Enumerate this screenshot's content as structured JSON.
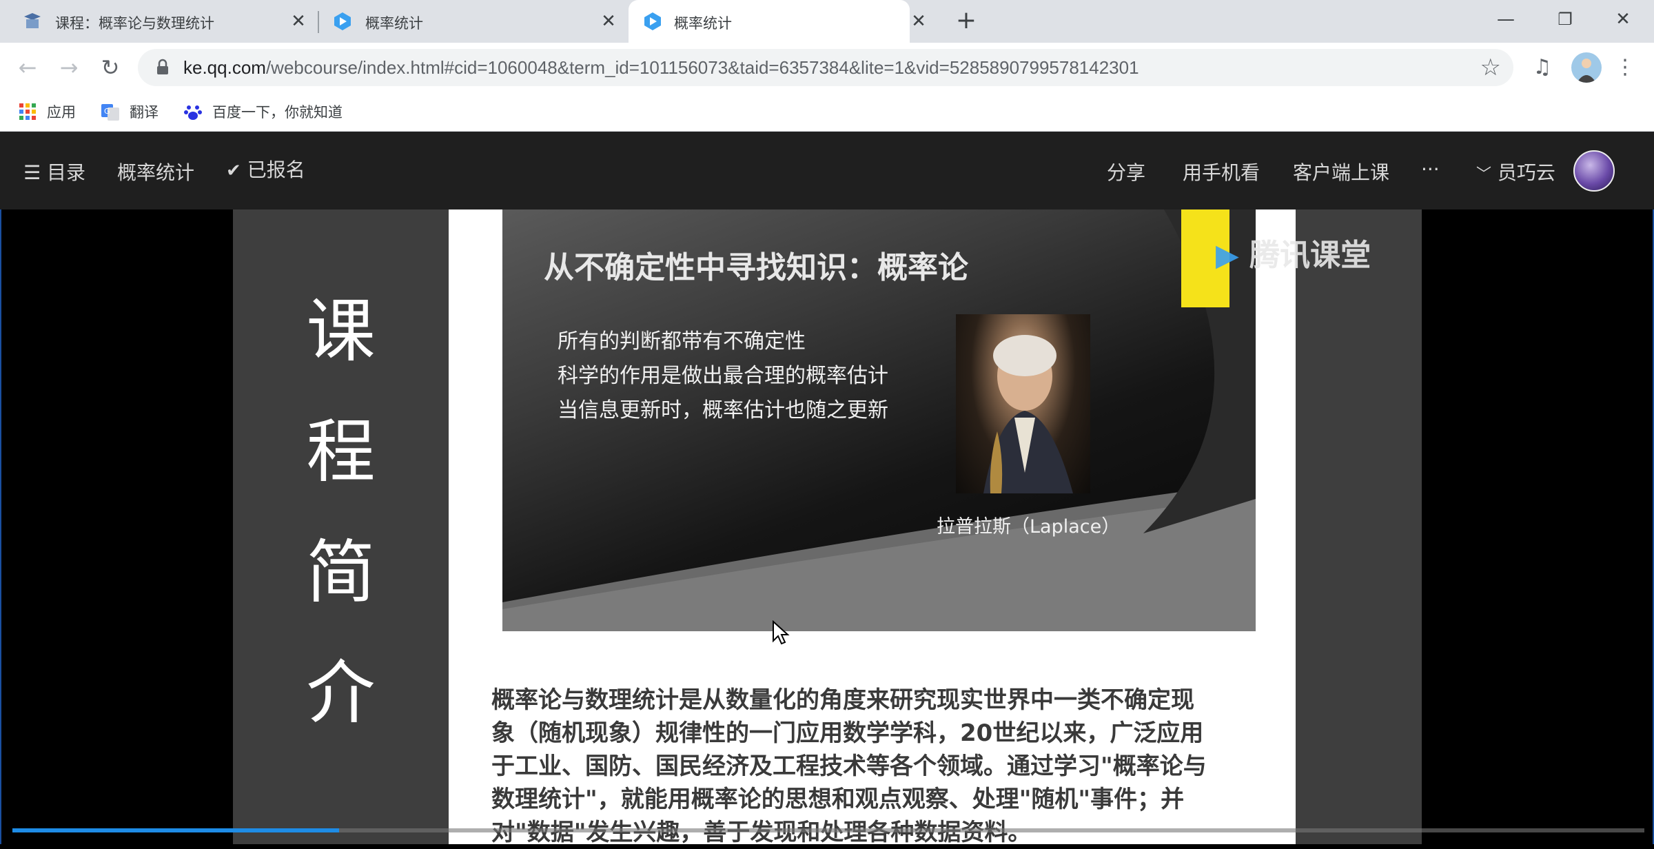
{
  "tabs": [
    {
      "title": "课程：概率论与数理统计",
      "active": false
    },
    {
      "title": "概率统计",
      "active": false
    },
    {
      "title": "概率统计",
      "active": true
    }
  ],
  "toolbar": {
    "url_host": "ke.qq.com",
    "url_path": "/webcourse/index.html#cid=1060048&term_id=101156073&taid=6357384&lite=1&vid=5285890799578142301"
  },
  "bookmarks": [
    {
      "label": "应用",
      "icon": "apps-grid-icon"
    },
    {
      "label": "翻译",
      "icon": "translate-icon"
    },
    {
      "label": "百度一下，你就知道",
      "icon": "baidu-paw-icon"
    }
  ],
  "header": {
    "menu_label": "☰ 目录",
    "course_label": "概率统计",
    "enrolled_label": "已报名",
    "share_label": "分享",
    "mobile_label": "用手机看",
    "client_label": "客户端上课",
    "more_label": "···",
    "user_name": "员巧云"
  },
  "video": {
    "side_title_chars": [
      "课",
      "程",
      "简",
      "介"
    ],
    "slide_title": "从不确定性中寻找知识：概率论",
    "slide_lines": [
      "所有的判断都带有不确定性",
      "科学的作用是做出最合理的概率估计",
      "当信息更新时，概率估计也随之更新"
    ],
    "portrait_caption": "拉普拉斯（Laplace）",
    "watermark": "腾讯课堂",
    "description_lines": [
      "概率论与数理统计是从数量化的角度来研究现实世界中一类不确定现",
      "象（随机现象）规律性的一门应用数学学科，20世纪以来，广泛应用",
      "于工业、国防、国民经济及工程技术等各个领域。通过学习\"概率论与",
      "数理统计\"，就能用概率论的思想和观点观察、处理\"随机\"事件；并",
      "对\"数据\"发生兴趣，善于发现和处理各种数据资料。"
    ],
    "progress_fraction": 0.2
  },
  "colors": {
    "accent": "#1e8ce6",
    "header_bg": "#1f1f1f",
    "tabstrip_bg": "#dee1e6"
  }
}
